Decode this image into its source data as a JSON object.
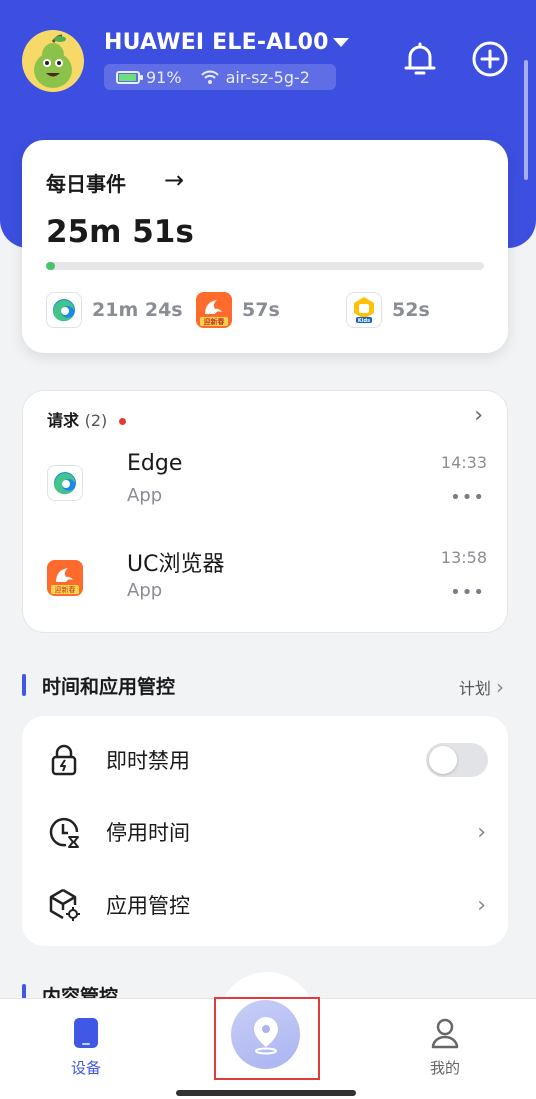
{
  "header": {
    "device_name": "HUAWEI ELE-AL00",
    "battery": "91%",
    "battery_level": 0.91,
    "wifi": "air-sz-5g-2"
  },
  "daily": {
    "title": "每日事件",
    "total": "25m 51s",
    "progress_fraction": 0.02,
    "apps": [
      {
        "name": "edge-icon",
        "time": "21m 24s"
      },
      {
        "name": "uc-icon",
        "time": "57s",
        "badge": "迎新春"
      },
      {
        "name": "kids-icon",
        "time": "52s",
        "badge": "Kids"
      }
    ]
  },
  "requests": {
    "title": "请求",
    "count": "(2)",
    "items": [
      {
        "name": "Edge",
        "type": "App",
        "time": "14:33",
        "more": "•••"
      },
      {
        "name": "UC浏览器",
        "type": "App",
        "time": "13:58",
        "more": "•••",
        "badge": "迎新春"
      }
    ]
  },
  "time_section": {
    "title": "时间和应用管控",
    "plan_label": "计划",
    "rows": [
      {
        "label": "即时禁用"
      },
      {
        "label": "停用时间"
      },
      {
        "label": "应用管控"
      }
    ]
  },
  "content_section": {
    "title": "内容管控"
  },
  "nav": {
    "device_label": "设备",
    "me_label": "我的"
  },
  "colors": {
    "accent": "#3d4fe0",
    "progress": "#45c46c",
    "badge_red": "#e53935"
  }
}
